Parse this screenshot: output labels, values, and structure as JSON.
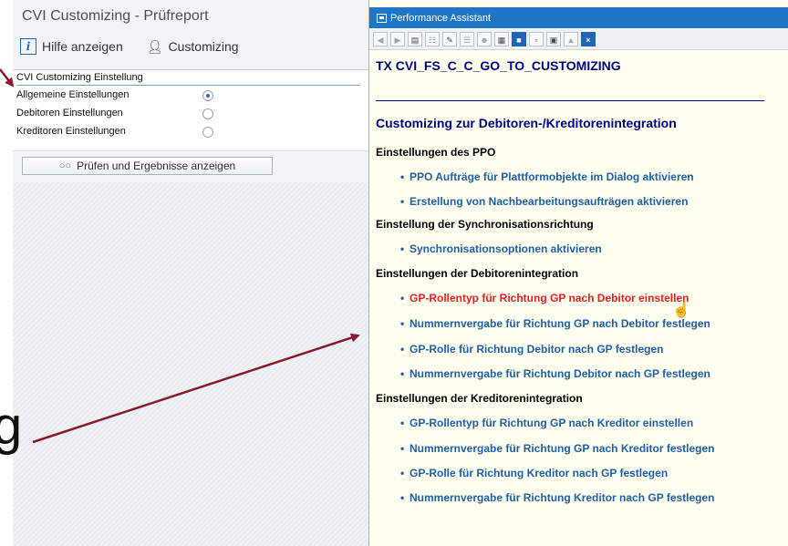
{
  "left_panel": {
    "title": "CVI Customizing - Prüfreport",
    "toolbar": {
      "help_label": "Hilfe anzeigen",
      "customizing_label": "Customizing"
    },
    "group": {
      "title": "CVI Customizing Einstellung",
      "options": [
        {
          "label": "Allgemeine Einstellungen",
          "selected": true
        },
        {
          "label": "Debitoren Einstellungen",
          "selected": false
        },
        {
          "label": "Kreditoren Einstellungen",
          "selected": false
        }
      ]
    },
    "check_button_label": "Prüfen und Ergebnisse anzeigen"
  },
  "performance_assistant": {
    "window_title": "Performance Assistant",
    "transaction": "TX CVI_FS_C_C_GO_TO_CUSTOMIZING",
    "heading": "Customizing zur Debitoren-/Kreditorenintegration",
    "sections": [
      {
        "title": "Einstellungen des PPO",
        "links": [
          "PPO Aufträge für Plattformobjekte im Dialog aktivieren",
          "Erstellung von Nachbearbeitungsaufträgen aktivieren"
        ]
      },
      {
        "title": "Einstellung der Synchronisationsrichtung",
        "links": [
          "Synchronisationsoptionen aktivieren"
        ]
      },
      {
        "title": "Einstellungen der Debitorenintegration",
        "links": [
          "GP-Rollentyp für Richtung GP nach Debitor einstellen",
          "Nummernvergabe für Richtung GP nach Debitor festlegen",
          "GP-Rolle für Richtung Debitor nach GP festlegen",
          "Nummernvergabe für Richtung Debitor nach GP festlegen"
        ]
      },
      {
        "title": "Einstellungen der Kreditorenintegration",
        "links": [
          "GP-Rollentyp für Richtung GP nach Kreditor einstellen",
          "Nummernvergabe für Richtung GP nach Kreditor festlegen",
          "GP-Rolle für Richtung Kreditor nach GP festlegen",
          "Nummernvergabe für Richtung Kreditor nach GP festlegen"
        ]
      }
    ],
    "link_color": "#1f5fa5",
    "hover_link_color": "#e31f1f"
  },
  "overlay": {
    "partial_text": "g",
    "arrow_color": "#8b1a2b"
  }
}
